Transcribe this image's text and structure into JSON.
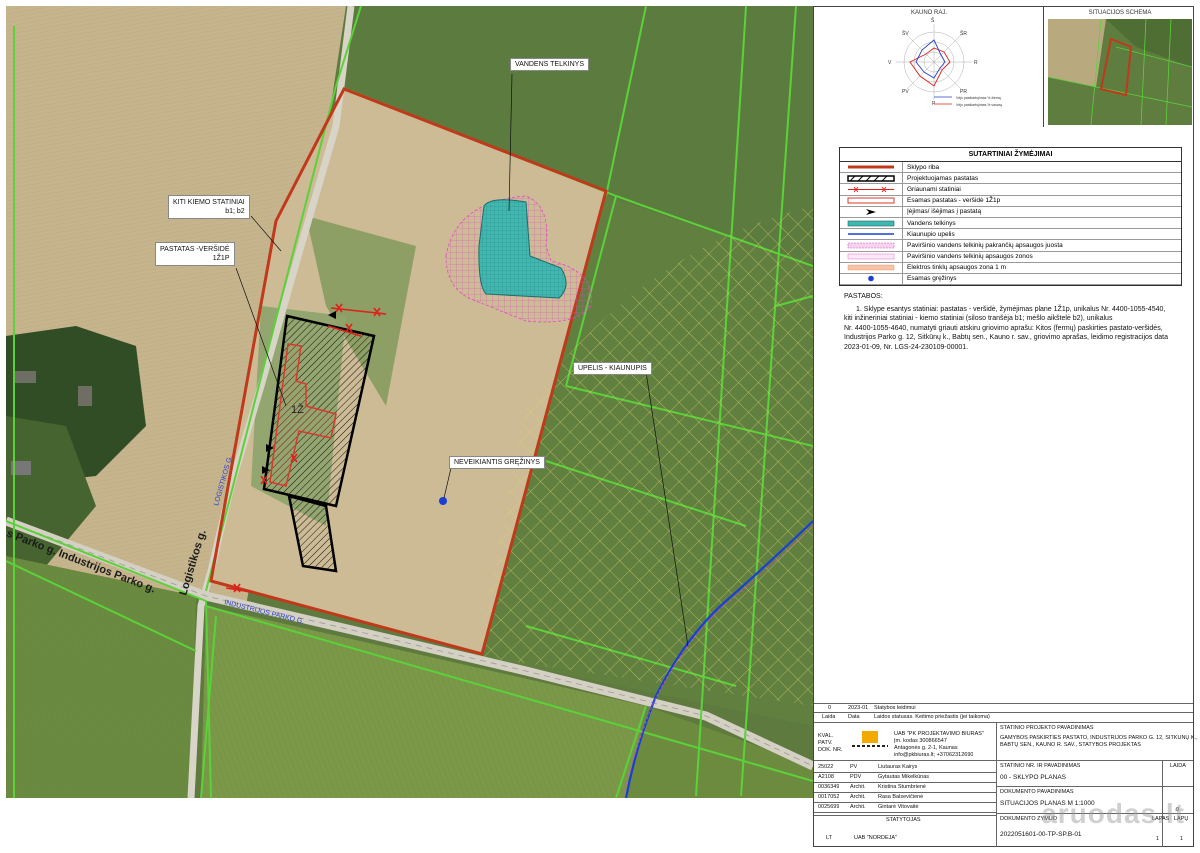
{
  "map": {
    "labels": {
      "water_body": "VANDENS TELKINYS",
      "other_structures_l1": "KITI KIEMO STATINIAI",
      "other_structures_l2": "b1; b2",
      "building_l1": "PASTATAS -VERŠIDĖ",
      "building_l2": "1Ž1P",
      "stream": "UPELIS - KIAUNUPIS",
      "well": "NEVEIKIANTIS GRĘŽINYS",
      "road_park_1": "s Parko g. Industrijos Parko g.",
      "road_logistikos": "Logistikos g.",
      "road_industrijos": "INDUSTRIJOS PARKO G.",
      "road_logistikos_small": "LOGISTIKOS G.",
      "building_number": "1Ž"
    },
    "colors": {
      "plot_boundary": "#c0391b",
      "cadastre_lines": "#5bd13a",
      "stream": "#1a3fd6",
      "designed_building": "#111111",
      "water": "#40b7b0"
    }
  },
  "wind_rose": {
    "title": "KAUNO RAJ.",
    "legend_1": "Vėjo pasikartojimas % žiemą",
    "legend_2": "Vėjo pasikartojimas % vasarą",
    "dirs": [
      "Š",
      "ŠR",
      "R",
      "PR",
      "P",
      "PV",
      "V",
      "ŠV"
    ]
  },
  "situation": {
    "title": "SITUACIJOS SCHEMA"
  },
  "legend": {
    "title": "SUTARTINIAI ŽYMĖJIMAI",
    "items": [
      {
        "text": "Sklypo riba",
        "sym": "plot"
      },
      {
        "text": "Projektuojamas pastatas",
        "sym": "design"
      },
      {
        "text": "Griaunami statiniai",
        "sym": "demolish"
      },
      {
        "text": "Esamas pastatas - veršidė 1Ž1p",
        "sym": "existing"
      },
      {
        "text": "Įėjimas/ išėjimas į pastatą",
        "sym": "entrance"
      },
      {
        "text": "Vandens telkinys",
        "sym": "water"
      },
      {
        "text": "Kiaunupio upelis",
        "sym": "stream"
      },
      {
        "text": "Paviršinio vandens telkinių pakrančių apsaugos juosta",
        "sym": "coast"
      },
      {
        "text": "Paviršinio vandens telkinių apsaugos zonos",
        "sym": "zone"
      },
      {
        "text": "Elektros tinklų apsaugos zona 1 m",
        "sym": "electric"
      },
      {
        "text": "Esamas gręžinys",
        "sym": "well"
      }
    ]
  },
  "notes": {
    "title": "PASTABOS:",
    "lines": [
      "1.    Sklype esantys statiniai: pastatas - veršidė, žymėjimas plane 1Ž1p, unikalus Nr. 4400-1055-4540,",
      "kiti inžineriniai statiniai - kiemo statiniai (siloso tranšėja b1; mėšlo aikštelė b2), unikalus",
      "Nr. 4400-1055-4640, numatyti griauti atskiru griovimo aprašu: Kitos (fermų) paskirties pastato-veršidės,",
      "Industrijos Parko g. 12, Sitkūnų k., Babtų sen., Kauno r. sav., griovimo aprašas, leidimo registracijos data",
      "2023-01-09,  Nr. LGS-24-230109-00001."
    ]
  },
  "title_block": {
    "rev_num": "0",
    "rev_date": "2023-01",
    "rev_desc": "Statybos leidimui",
    "rev_h1": "Laida",
    "rev_h2": "Data",
    "rev_h3": "Laidos statusas. Keitimo priežastis (jei taikoma)",
    "qual_lines": [
      "KVAL.",
      "PATV.",
      "DOK. NR."
    ],
    "company": "UAB \"PK PROJEKTAVIMO BIURAS\"",
    "company_code": "Įm. kodas 300866547",
    "company_addr": "Antagonės g. 2-1, Kaunas",
    "company_contact": "info@pkbiuras.lt; +37062312690",
    "project_name_h": "STATINIO PROJEKTO PAVADINIMAS",
    "project_name_1": "GAMYBOS PASKIRTIES PASTATO, INDUSTRIJOS PARKO G. 12, SITKŪNŲ K.,",
    "project_name_2": "BABTŲ SEN., KAUNO R. SAV., STATYBOS PROJEKTAS",
    "part_h": "STATINIO NR. IR PAVADINIMAS",
    "part": "00 - SKLYPO PLANAS",
    "doc_h": "DOKUMENTO PAVADINIMAS",
    "doc": "SITUACIJOS PLANAS M 1:1000",
    "laida_h": "LAIDA",
    "laida": "0",
    "doc_code_h": "DOKUMENTO ŽYMUO",
    "lapas_h": "LAPAS",
    "lapu_h": "LAPŲ",
    "doc_code": "2022051601-00-TP-SP.B-01",
    "lapas": "1",
    "lapu": "1",
    "people": [
      {
        "num": "25022",
        "role": "PV",
        "name": "Liutauras Kairys"
      },
      {
        "num": "A2108",
        "role": "PDV",
        "name": "Gytautas Mikelkūnas"
      },
      {
        "num": "0036349",
        "role": "Archit.",
        "name": "Kristina Stumbrienė"
      },
      {
        "num": "0017052",
        "role": "Archit.",
        "name": "Rasa Balsevičienė"
      },
      {
        "num": "0025699",
        "role": "Archit.",
        "name": "Gintarė Vitovaitė"
      }
    ],
    "client_h": "STATYTOJAS",
    "country": "LT",
    "client": "UAB \"NORDEJA\""
  },
  "watermark": "aruodas.lt"
}
